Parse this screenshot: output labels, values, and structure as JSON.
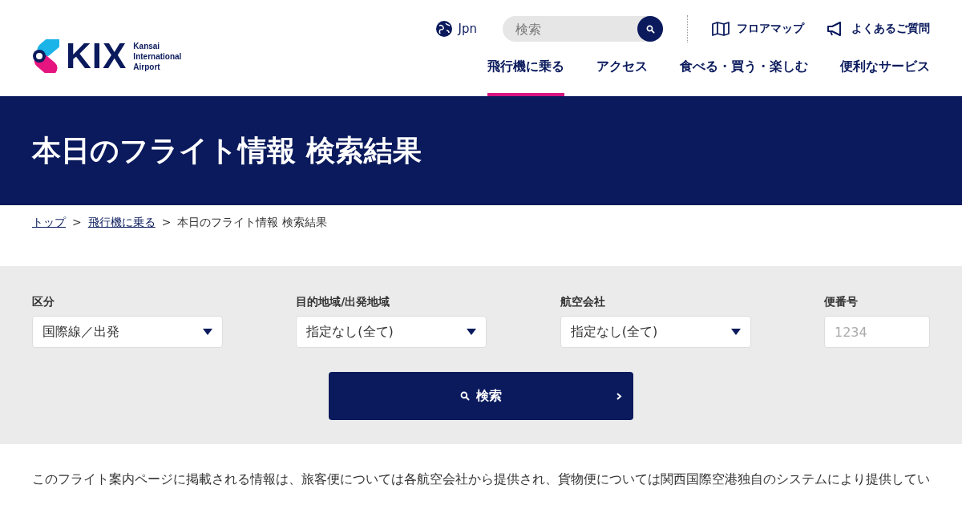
{
  "logo": {
    "mark": "KIX",
    "name_lines": [
      "Kansai",
      "International",
      "Airport"
    ]
  },
  "utility": {
    "language": "Jpn",
    "search": {
      "placeholder": "検索"
    },
    "links": [
      "フロアマップ",
      "よくあるご質問"
    ]
  },
  "nav": [
    {
      "label": "飛行機に乗る",
      "selected": true
    },
    {
      "label": "アクセス",
      "selected": false
    },
    {
      "label": "食べる・買う・楽しむ",
      "selected": false
    },
    {
      "label": "便利なサービス",
      "selected": false
    }
  ],
  "page_title": "本日のフライト情報 検索結果",
  "breadcrumb": {
    "separator": ">",
    "items": [
      {
        "label": "トップ",
        "kind": "link"
      },
      {
        "label": "飛行機に乗る",
        "kind": "link"
      },
      {
        "label": "本日のフライト情報 検索結果",
        "kind": "current"
      }
    ]
  },
  "search_form": {
    "fields": [
      {
        "label": "区分",
        "kind": "select",
        "value": "国際線／出発"
      },
      {
        "label": "目的地域/出発地域",
        "kind": "select",
        "value": "指定なし(全て)"
      },
      {
        "label": "航空会社",
        "kind": "select",
        "value": "指定なし(全て)"
      },
      {
        "label": "便番号",
        "kind": "input",
        "placeholder": "1234"
      }
    ],
    "submit": "検索"
  },
  "notice": "このフライト案内ページに掲載される情報は、旅客便については各航空会社から提供され、貨物便については関西国際空港独自のシステムにより提供してい"
}
